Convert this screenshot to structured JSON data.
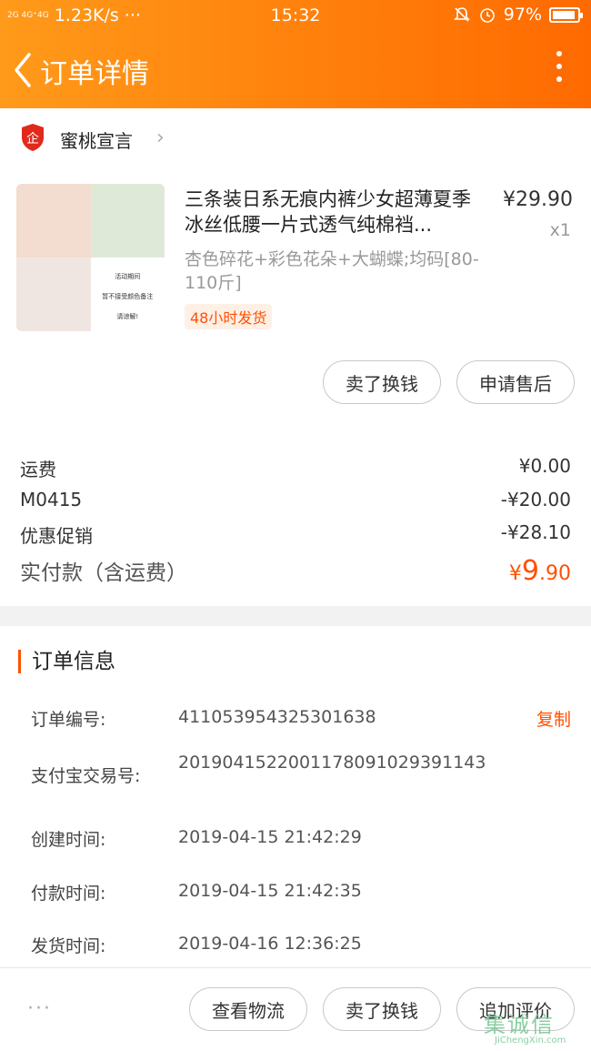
{
  "status_bar": {
    "network": "2G 4G⁺4G",
    "speed": "1.23K/s",
    "more": "···",
    "time": "15:32",
    "battery": "97%"
  },
  "nav": {
    "title": "订单详情"
  },
  "store": {
    "badge_char": "企",
    "name": "蜜桃宣言"
  },
  "product": {
    "title": "三条装日系无痕内裤少女超薄夏季冰丝低腰一片式透气纯棉裆...",
    "price": "¥29.90",
    "quantity": "x1",
    "sku": "杏色碎花+彩色花朵+大蝴蝶;均码[80-110斤]",
    "tag": "48小时发货",
    "thumb_text_1": "活动期间",
    "thumb_text_2": "暂不接受颜色备注",
    "thumb_text_3": "请谅解!"
  },
  "item_actions": {
    "sell_label": "卖了换钱",
    "aftersale_label": "申请售后"
  },
  "fees": [
    {
      "label": "运费",
      "value": "¥0.00"
    },
    {
      "label": "M0415",
      "value": "-¥20.00"
    },
    {
      "label": "优惠促销",
      "value": "-¥28.10"
    }
  ],
  "total": {
    "label": "实付款（含运费）",
    "currency": "¥",
    "integer": "9",
    "decimal": ".90"
  },
  "order_info": {
    "heading": "订单信息",
    "copy_label": "复制",
    "rows": [
      {
        "label": "订单编号:",
        "value": "411053954325301638"
      },
      {
        "label": "支付宝交易号:",
        "value": "2019041522001178091029391143"
      },
      {
        "label": "创建时间:",
        "value": "2019-04-15 21:42:29"
      },
      {
        "label": "付款时间:",
        "value": "2019-04-15 21:42:35"
      },
      {
        "label": "发货时间:",
        "value": "2019-04-16 12:36:25"
      }
    ]
  },
  "bottom_bar": {
    "more_label": "···",
    "logistics_label": "查看物流",
    "sell_label": "卖了换钱",
    "review_label": "追加评价"
  },
  "watermark": {
    "top": "集诚信",
    "bottom": "JiChengXin.com"
  },
  "colors": {
    "header_start": "#ff9a1a",
    "header_end": "#ff6a00",
    "accent": "#ff5000"
  }
}
